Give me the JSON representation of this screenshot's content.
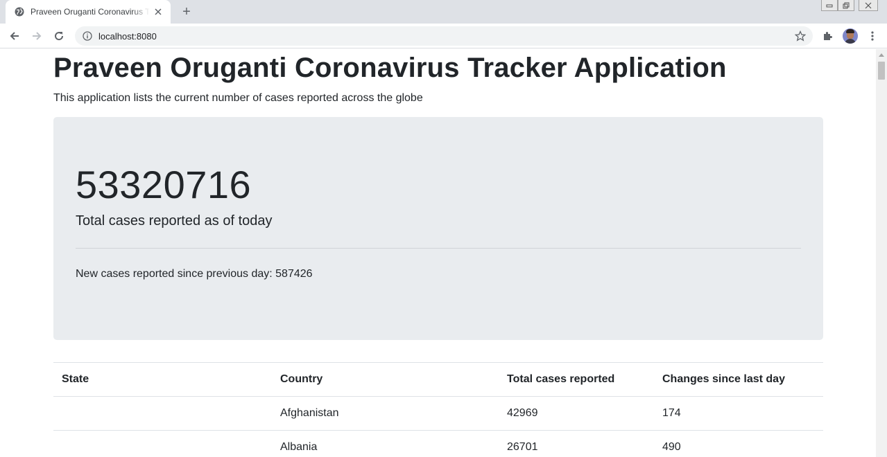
{
  "browser": {
    "tab_title": "Praveen Oruganti Coronavirus Tracker Application",
    "new_tab_symbol": "+",
    "url": "localhost:8080"
  },
  "page": {
    "title": "Praveen Oruganti Coronavirus Tracker Application",
    "subtitle": "This application lists the current number of cases reported across the globe",
    "total_cases": "53320716",
    "total_label": "Total cases reported as of today",
    "new_cases_text": "New cases reported since previous day: 587426"
  },
  "table": {
    "headers": {
      "state": "State",
      "country": "Country",
      "total": "Total cases reported",
      "changes": "Changes since last day"
    },
    "rows": [
      {
        "state": "",
        "country": "Afghanistan",
        "total": "42969",
        "changes": "174"
      },
      {
        "state": "",
        "country": "Albania",
        "total": "26701",
        "changes": "490"
      }
    ]
  },
  "colors": {
    "jumbotron_bg": "#e9ecef",
    "text": "#212529",
    "tabbar_bg": "#dee1e6"
  },
  "icons": [
    "globe-icon",
    "close-icon",
    "back-icon",
    "forward-icon",
    "reload-icon",
    "info-icon",
    "star-icon",
    "extensions-icon",
    "menu-icon"
  ]
}
